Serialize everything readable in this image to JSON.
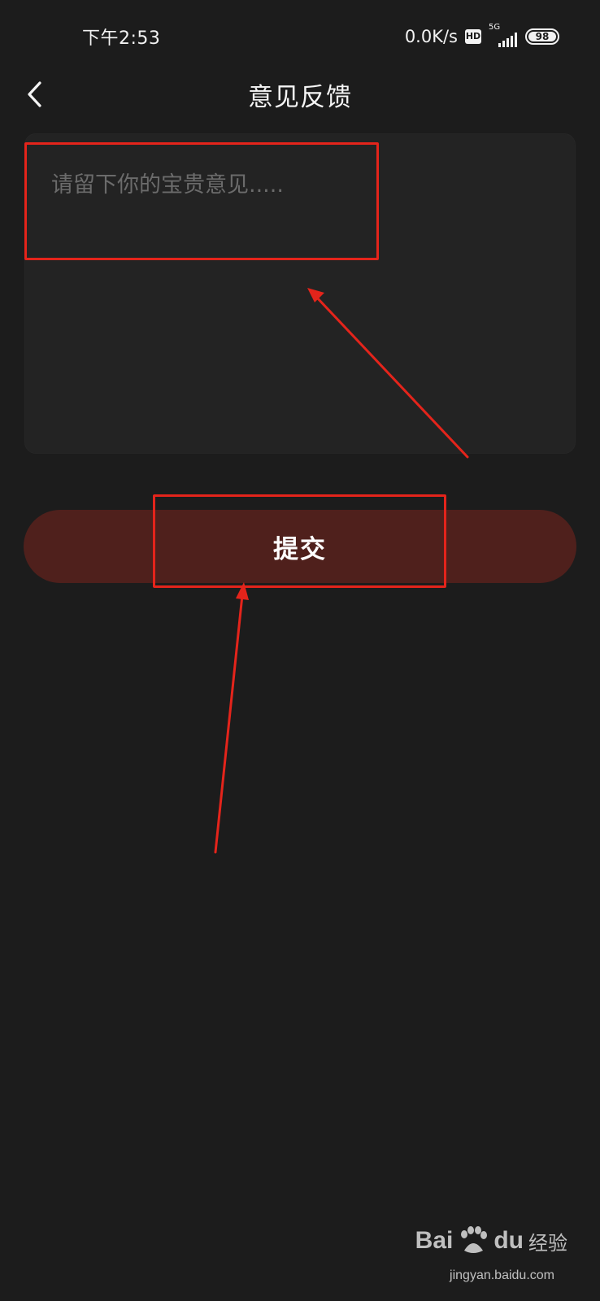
{
  "status_bar": {
    "time": "下午2:53",
    "net_speed": "0.0K/s",
    "hd_label": "HD",
    "network_type": "5G",
    "battery_level": "98"
  },
  "header": {
    "title": "意见反馈",
    "back_icon": "chevron-left-icon"
  },
  "feedback": {
    "placeholder": "请留下你的宝贵意见.....",
    "value": ""
  },
  "submit": {
    "label": "提交"
  },
  "colors": {
    "background": "#1c1c1c",
    "input_background": "#232323",
    "submit_background": "#4f201c",
    "annotation_red": "#e4241b"
  },
  "watermark": {
    "brand_left": "Bai",
    "brand_right": "du",
    "brand_cn": "经验",
    "url": "jingyan.baidu.com"
  }
}
